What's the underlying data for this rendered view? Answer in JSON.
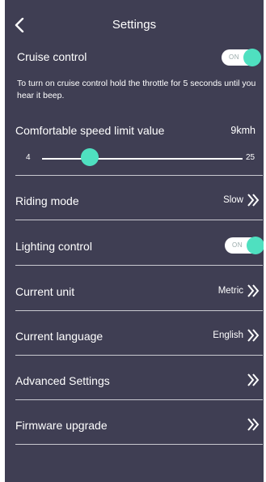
{
  "header": {
    "title": "Settings"
  },
  "cruise": {
    "label": "Cruise control",
    "toggle_text": "ON",
    "description": "To turn on cruise control hold the throttle for 5 seconds until you hear it beep."
  },
  "speed": {
    "label": "Comfortable speed limit value",
    "value": "9kmh",
    "min": "4",
    "max": "25",
    "current": 9
  },
  "rows": [
    {
      "label": "Riding mode",
      "value": "Slow"
    },
    {
      "label": "Lighting control",
      "toggle_text": "ON"
    },
    {
      "label": "Current unit",
      "value": "Metric"
    },
    {
      "label": "Current language",
      "value": "English"
    },
    {
      "label": "Advanced Settings",
      "value": ""
    },
    {
      "label": "Firmware upgrade",
      "value": ""
    }
  ],
  "colors": {
    "background": "#3f3e53",
    "accent": "#4fe0c0"
  }
}
